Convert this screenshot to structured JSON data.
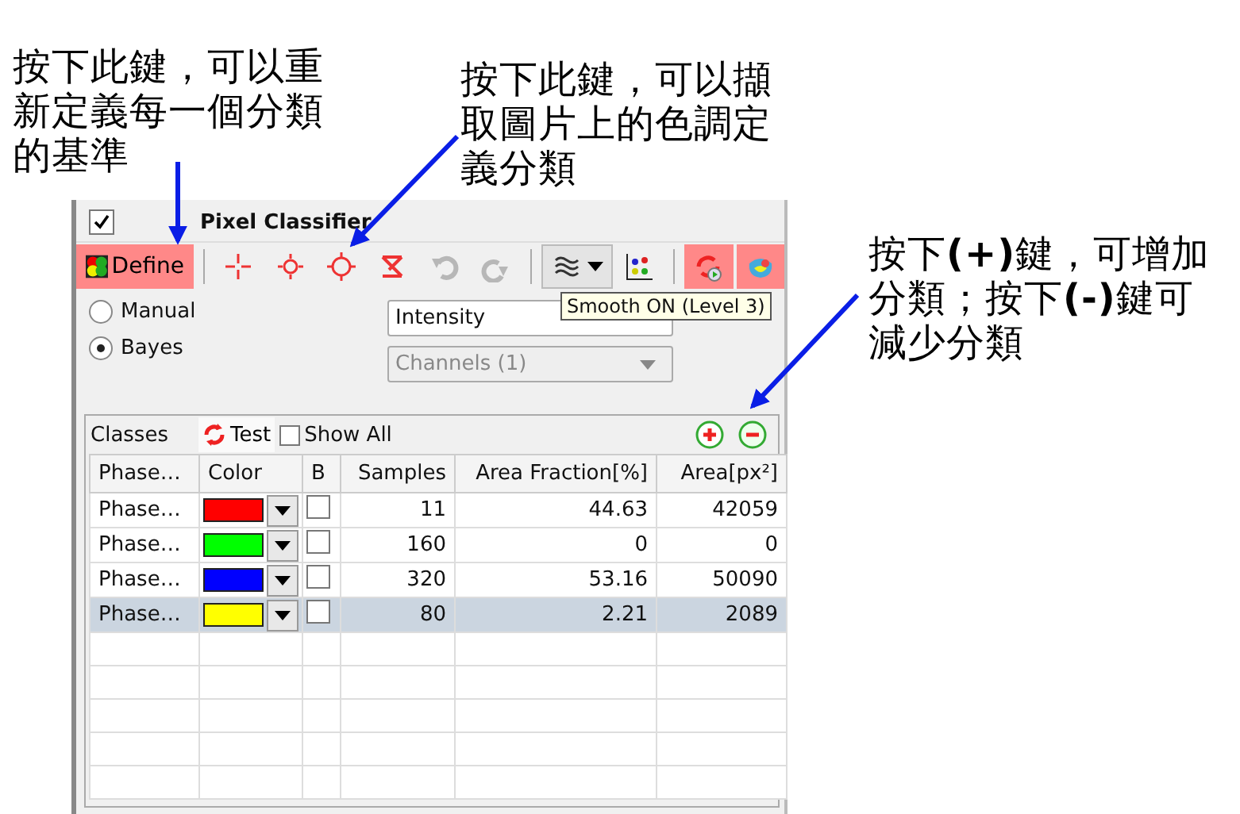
{
  "annotations": [
    {
      "text": "按下此鍵，可以重新定義每一個分類的基準"
    },
    {
      "text": "按下此鍵，可以擷取圖片上的色調定義分類"
    },
    {
      "text": "按下**(+)**鍵，可增加分類；按下**(-)**鍵可減少分類"
    }
  ],
  "panel": {
    "title": "Pixel Classifier",
    "checked": true,
    "define_button": {
      "label": "Define",
      "on": true
    },
    "tools": [
      {
        "kind": "cross",
        "on": false,
        "disabled": false
      },
      {
        "kind": "point",
        "on": false,
        "disabled": false
      },
      {
        "kind": "circle",
        "on": false,
        "disabled": false
      },
      {
        "kind": "clear",
        "on": false,
        "disabled": false
      },
      {
        "kind": "undo",
        "on": false,
        "disabled": true
      },
      {
        "kind": "redo",
        "on": false,
        "disabled": true
      },
      {
        "kind": "smooth",
        "on": false,
        "disabled": false
      },
      {
        "kind": "scatter",
        "on": false,
        "disabled": false
      },
      {
        "kind": "refresh",
        "on": true,
        "disabled": false
      },
      {
        "kind": "segment",
        "on": true,
        "disabled": false
      }
    ],
    "tooltip": "Smooth ON (Level 3)",
    "modes": [
      {
        "label": "Manual",
        "selected": false
      },
      {
        "label": "Bayes",
        "selected": true
      }
    ],
    "feature_dropdown": {
      "value": "Intensity",
      "disabled": false
    },
    "channels_dropdown": {
      "value": "Channels (1)",
      "disabled": true
    },
    "classes": {
      "title": "Classes",
      "test_button": "Test",
      "show_all": {
        "label": "Show All",
        "checked": false
      },
      "table": {
        "columns": [
          "Phase…",
          "Color",
          "B",
          "Samples",
          "Area Fraction[%]",
          "Area[px²]"
        ],
        "rows": [
          {
            "name": "Phase…",
            "color": "#ff0000",
            "b": false,
            "samples": "11",
            "fraction": "44.63",
            "area": "42059",
            "selected": false
          },
          {
            "name": "Phase…",
            "color": "#00ff00",
            "b": false,
            "samples": "160",
            "fraction": "0",
            "area": "0",
            "selected": false
          },
          {
            "name": "Phase…",
            "color": "#0000ff",
            "b": false,
            "samples": "320",
            "fraction": "53.16",
            "area": "50090",
            "selected": false
          },
          {
            "name": "Phase…",
            "color": "#ffff00",
            "b": false,
            "samples": "80",
            "fraction": "2.21",
            "area": "2089",
            "selected": true
          }
        ]
      }
    }
  }
}
